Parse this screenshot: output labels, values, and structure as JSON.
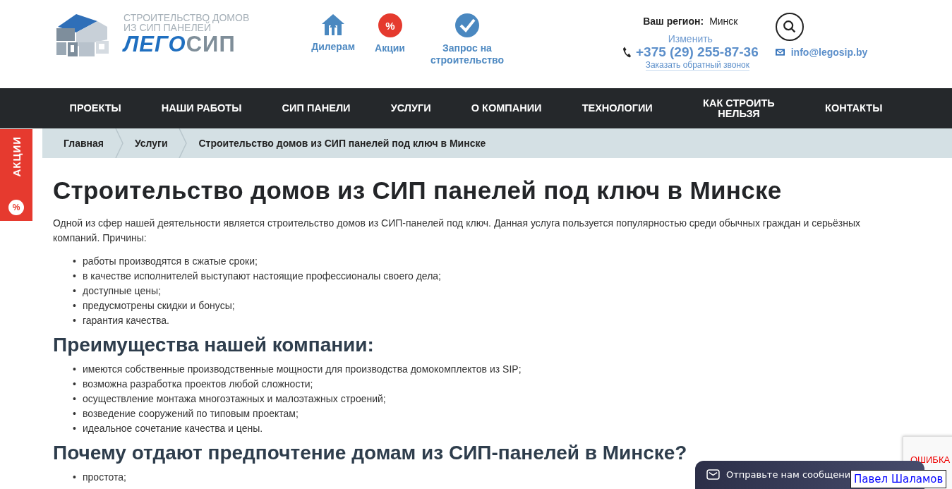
{
  "header": {
    "logo": {
      "tagline_1": "СТРОИТЕЛЬСТВО ДОМОВ",
      "tagline_2": "ИЗ СИП ПАНЕЛЕЙ",
      "name_part_1": "ЛЕГО",
      "name_part_2": "СИП"
    },
    "quick_links": [
      {
        "kind": "house",
        "label": "Дилерам"
      },
      {
        "kind": "percent",
        "label": "Акции",
        "badge": "%"
      },
      {
        "kind": "check",
        "label": "Запрос на строительство"
      }
    ],
    "region": {
      "label": "Ваш регион:",
      "value": "Минск",
      "change": "Изменить"
    },
    "phone": "+375 (29) 255-87-36",
    "callback": "Заказать обратный звонок",
    "email": "info@legosip.by"
  },
  "nav": [
    "ПРОЕКТЫ",
    "НАШИ РАБОТЫ",
    "СИП ПАНЕЛИ",
    "УСЛУГИ",
    "О КОМПАНИИ",
    "ТЕХНОЛОГИИ",
    "КАК СТРОИТЬ НЕЛЬЗЯ",
    "КОНТАКТЫ"
  ],
  "breadcrumbs": [
    "Главная",
    "Услуги",
    "Строительство домов из СИП панелей под ключ в Минске"
  ],
  "promo_tab": {
    "label": "АКЦИИ",
    "badge": "%"
  },
  "content": {
    "bullet": "•",
    "title": "Строительство домов из СИП панелей под ключ в Минске",
    "intro": "Одной из сфер нашей деятельности является строительство домов из СИП-панелей под ключ. Данная услуга пользуется популярностью среди обычных граждан и серьёзных компаний. Причины:",
    "reasons": [
      "работы производятся в сжатые сроки;",
      "в качестве исполнителей выступают настоящие профессионалы своего дела;",
      "доступные цены;",
      "предусмотрены скидки и бонусы;",
      "гарантия качества."
    ],
    "advantages_heading": "Преимущества нашей компании:",
    "advantages": [
      "имеются собственные производственные мощности для производства домокомплектов из SIP;",
      "возможна разработка проектов любой сложности;",
      "осуществление монтажа многоэтажных и малоэтажных строений;",
      "возведение сооружений по типовым проектам;",
      "идеальное сочетание качества и цены."
    ],
    "why_heading": "Почему отдают предпочтение домам из СИП-панелей в Минске?",
    "why": [
      "простота;"
    ]
  },
  "chat_widget": {
    "label": "Отправьте нам сообщени",
    "overlay_name": "Павел Шаламов"
  },
  "captcha": {
    "error": "ОШИБКА"
  }
}
